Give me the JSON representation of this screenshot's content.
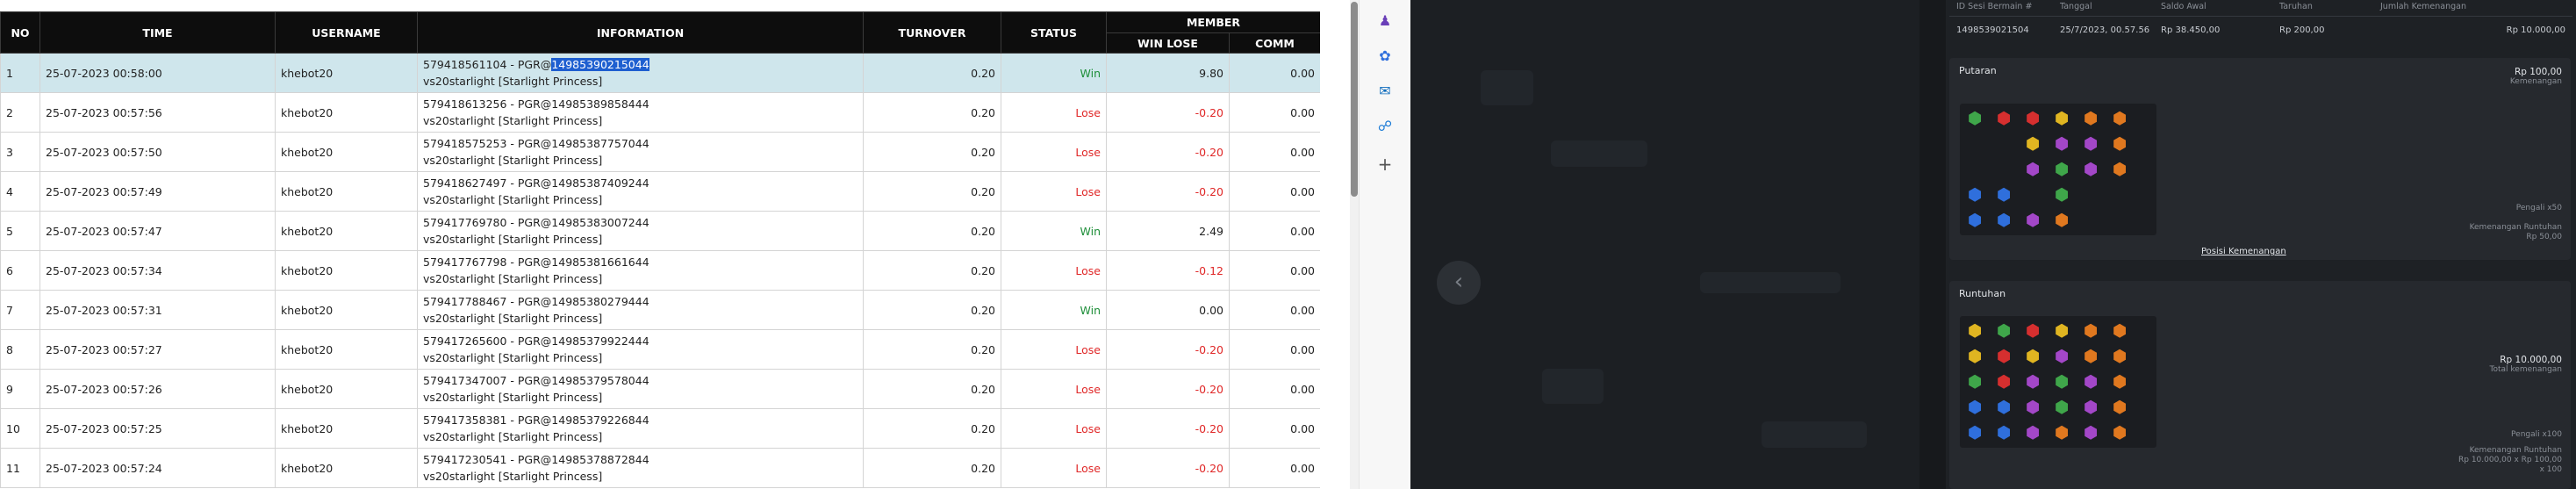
{
  "table": {
    "headers": {
      "no": "NO",
      "time": "TIME",
      "username": "USERNAME",
      "information": "INFORMATION",
      "turnover": "TURNOVER",
      "status": "STATUS",
      "member": "MEMBER",
      "win_lose": "WIN LOSE",
      "comm": "COMM"
    },
    "rows": [
      {
        "no": "1",
        "time": "25-07-2023 00:58:00",
        "username": "khebot20",
        "info1_pre": "579418561104 - PGR@",
        "info1_hl": "14985390215044",
        "info2": "vs20starlight [Starlight Princess]",
        "turnover": "0.20",
        "status": "Win",
        "win_lose": "9.80",
        "comm": "0.00"
      },
      {
        "no": "2",
        "time": "25-07-2023 00:57:56",
        "username": "khebot20",
        "info1_pre": "579418613256 - PGR@14985389858444",
        "info1_hl": "",
        "info2": "vs20starlight [Starlight Princess]",
        "turnover": "0.20",
        "status": "Lose",
        "win_lose": "-0.20",
        "comm": "0.00"
      },
      {
        "no": "3",
        "time": "25-07-2023 00:57:50",
        "username": "khebot20",
        "info1_pre": "579418575253 - PGR@14985387757044",
        "info1_hl": "",
        "info2": "vs20starlight [Starlight Princess]",
        "turnover": "0.20",
        "status": "Lose",
        "win_lose": "-0.20",
        "comm": "0.00"
      },
      {
        "no": "4",
        "time": "25-07-2023 00:57:49",
        "username": "khebot20",
        "info1_pre": "579418627497 - PGR@14985387409244",
        "info1_hl": "",
        "info2": "vs20starlight [Starlight Princess]",
        "turnover": "0.20",
        "status": "Lose",
        "win_lose": "-0.20",
        "comm": "0.00"
      },
      {
        "no": "5",
        "time": "25-07-2023 00:57:47",
        "username": "khebot20",
        "info1_pre": "579417769780 - PGR@14985383007244",
        "info1_hl": "",
        "info2": "vs20starlight [Starlight Princess]",
        "turnover": "0.20",
        "status": "Win",
        "win_lose": "2.49",
        "comm": "0.00"
      },
      {
        "no": "6",
        "time": "25-07-2023 00:57:34",
        "username": "khebot20",
        "info1_pre": "579417767798 - PGR@14985381661644",
        "info1_hl": "",
        "info2": "vs20starlight [Starlight Princess]",
        "turnover": "0.20",
        "status": "Lose",
        "win_lose": "-0.12",
        "comm": "0.00"
      },
      {
        "no": "7",
        "time": "25-07-2023 00:57:31",
        "username": "khebot20",
        "info1_pre": "579417788467 - PGR@14985380279444",
        "info1_hl": "",
        "info2": "vs20starlight [Starlight Princess]",
        "turnover": "0.20",
        "status": "Win",
        "win_lose": "0.00",
        "comm": "0.00"
      },
      {
        "no": "8",
        "time": "25-07-2023 00:57:27",
        "username": "khebot20",
        "info1_pre": "579417265600 - PGR@14985379922444",
        "info1_hl": "",
        "info2": "vs20starlight [Starlight Princess]",
        "turnover": "0.20",
        "status": "Lose",
        "win_lose": "-0.20",
        "comm": "0.00"
      },
      {
        "no": "9",
        "time": "25-07-2023 00:57:26",
        "username": "khebot20",
        "info1_pre": "579417347007 - PGR@14985379578044",
        "info1_hl": "",
        "info2": "vs20starlight [Starlight Princess]",
        "turnover": "0.20",
        "status": "Lose",
        "win_lose": "-0.20",
        "comm": "0.00"
      },
      {
        "no": "10",
        "time": "25-07-2023 00:57:25",
        "username": "khebot20",
        "info1_pre": "579417358381 - PGR@14985379226844",
        "info1_hl": "",
        "info2": "vs20starlight [Starlight Princess]",
        "turnover": "0.20",
        "status": "Lose",
        "win_lose": "-0.20",
        "comm": "0.00"
      },
      {
        "no": "11",
        "time": "25-07-2023 00:57:24",
        "username": "khebot20",
        "info1_pre": "579417230541 - PGR@14985378872844",
        "info1_hl": "",
        "info2": "vs20starlight [Starlight Princess]",
        "turnover": "0.20",
        "status": "Lose",
        "win_lose": "-0.20",
        "comm": "0.00"
      }
    ]
  },
  "sidebar_icons": [
    "person-icon",
    "copilot-icon",
    "outlook-icon",
    "shopping-icon",
    "add-icon"
  ],
  "detail": {
    "headers": [
      "ID Sesi Bermain #",
      "Tanggal",
      "Saldo Awal",
      "Taruhan",
      "Jumlah Kemenangan"
    ],
    "row": {
      "id": "1498539021504",
      "date": "25/7/2023, 00.57.56",
      "saldo": "Rp 38.450,00",
      "bet": "Rp 200,00",
      "win": "Rp 10.000,00"
    },
    "putaran": {
      "title": "Putaran",
      "amount": "Rp 100,00",
      "amount_label": "Kemenangan",
      "small1": "Pengali x50",
      "small2": "Kemenangan Runtuhan",
      "small3": "Rp 50,00",
      "link": "Posisi Kemenangan"
    },
    "runtuhan": {
      "title": "Runtuhan",
      "amount": "Rp 10.000,00",
      "amount_label": "Total kemenangan",
      "small1": "Pengali x100",
      "small2": "Kemenangan Runtuhan",
      "small3": "Rp 10.000,00 x Rp 100,00",
      "small4": "x 100"
    }
  },
  "colors": {
    "header_bg": "#0d0d0d",
    "selected_row": "#cfe6ec",
    "win": "#1f8f3a",
    "lose": "#e02828",
    "highlight": "#1e5fd0",
    "dark_bg": "#17191c"
  }
}
